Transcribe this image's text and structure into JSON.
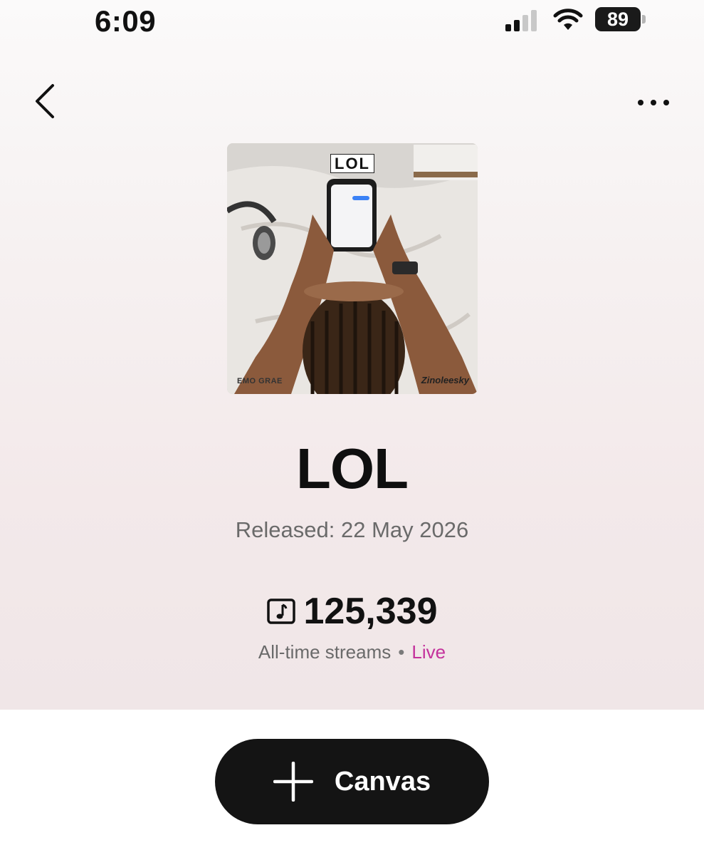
{
  "status_bar": {
    "time": "6:09",
    "battery": "89"
  },
  "nav": {
    "back_icon": "chevron-left-icon",
    "more_icon": "more-horizontal-icon"
  },
  "artwork": {
    "title_text": "LOL",
    "left_tag": "EMO GRAE",
    "right_tag": "Zinoleesky"
  },
  "song": {
    "title": "LOL",
    "released": "Released: 22 May 2026",
    "streams_count": "125,339",
    "streams_label": "All-time streams",
    "separator": "•",
    "live_label": "Live",
    "live_color": "#c4329c"
  },
  "canvas_button": {
    "label": "Canvas",
    "icon": "plus-icon"
  }
}
